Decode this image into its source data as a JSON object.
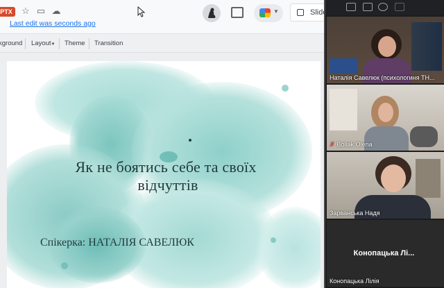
{
  "toolbar": {
    "file_badge": "PTX",
    "last_edit": "Last edit was seconds ago",
    "slideshow_label": "Slide"
  },
  "menubar": {
    "items": [
      "kground",
      "Layout",
      "Theme",
      "Transition"
    ]
  },
  "slide": {
    "title_line1": "Як не боятись себе та своїх",
    "title_line2": "відчуттів",
    "speaker": "Спікерка: НАТАЛІЯ САВЕЛЮК"
  },
  "call": {
    "participants": [
      {
        "name": "Наталія Савелюк (психологиня ТН...",
        "muted": false
      },
      {
        "name": "Boliak Olena",
        "muted": true
      },
      {
        "name": "Зарванська Надя",
        "muted": false
      },
      {
        "name": "Конопацька Лілія",
        "display": "Конопацька Лі...",
        "muted": false,
        "video_off": true
      }
    ]
  },
  "colors": {
    "accent": "#1a73e8",
    "splash_teal": "#79c4be",
    "badge": "#d64a2d",
    "panel": "#1c1c1c",
    "muted": "#ff4b4b"
  },
  "icons": [
    "star-icon",
    "move-to-folder-icon",
    "cloud-status-icon",
    "mouse-cursor-icon",
    "user-avatar",
    "comment-icon",
    "meet-camera-icon",
    "present-icon",
    "mic-off-icon"
  ]
}
